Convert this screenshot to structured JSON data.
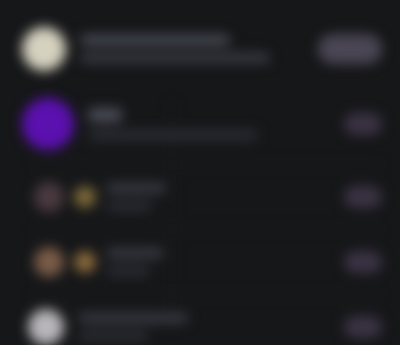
{
  "colors": {
    "background": "#161719",
    "header_avatar": "#d6d2c0",
    "featured_avatar": "#5b10b0",
    "row3_avatar": "#4a3a40",
    "row3_dot": "#7d6a3a",
    "row4_avatar": "#7a5c48",
    "row4_dot": "#8a6a3c",
    "row5_avatar": "#b8b6ba",
    "pill": "#3b3344"
  },
  "rows": [
    {
      "kind": "header",
      "avatar_icon": "avatar-icon",
      "pill": "wide"
    },
    {
      "kind": "featured",
      "avatar_icon": "avatar-icon",
      "pill": "normal"
    },
    {
      "kind": "list",
      "avatar_icon": "avatar-icon",
      "pill": "normal"
    },
    {
      "kind": "list",
      "avatar_icon": "avatar-icon",
      "pill": "normal"
    },
    {
      "kind": "list",
      "avatar_icon": "avatar-icon",
      "pill": "normal"
    }
  ]
}
